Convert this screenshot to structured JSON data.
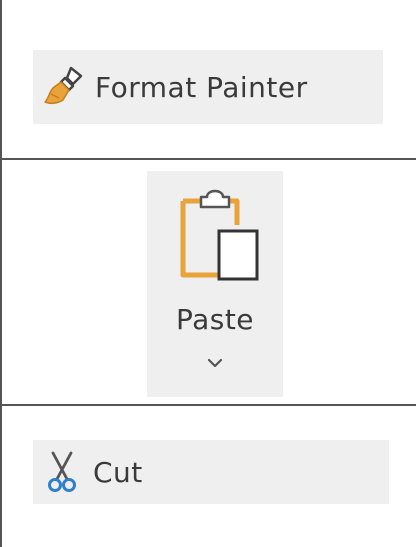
{
  "ribbon": {
    "format_painter": {
      "label": "Format Painter",
      "icon": "paintbrush-icon"
    },
    "paste": {
      "label": "Paste",
      "icon": "clipboard-icon",
      "dropdown_icon": "chevron-down-icon"
    },
    "cut": {
      "label": "Cut",
      "icon": "scissors-icon"
    }
  },
  "colors": {
    "accent_orange": "#e8a33a",
    "scissors_blue": "#2f7fd1",
    "button_bg": "#efefef",
    "divider": "#555555"
  }
}
